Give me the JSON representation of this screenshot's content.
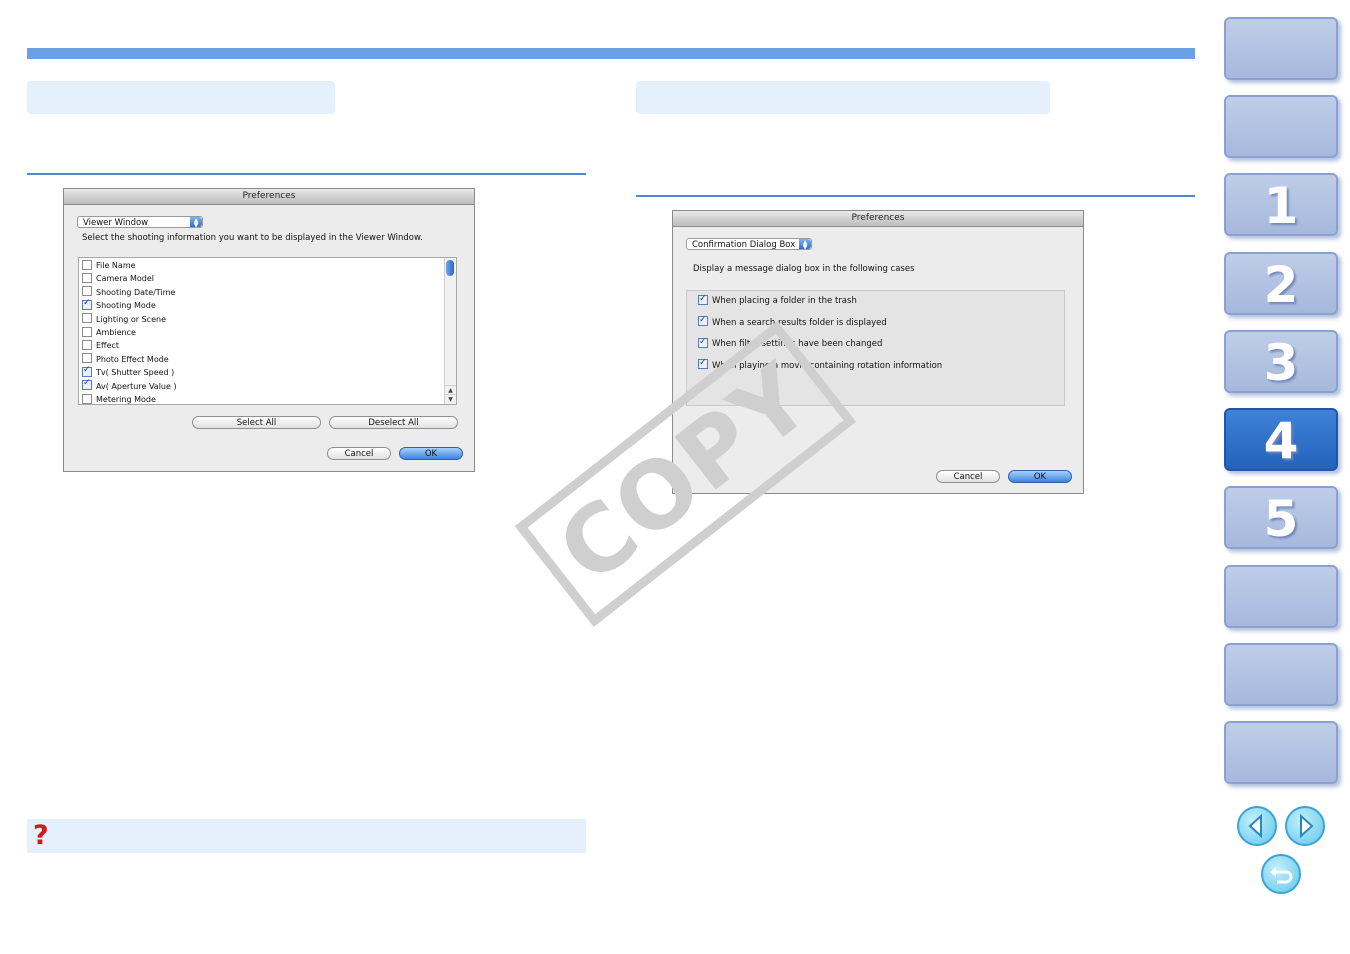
{
  "left_dialog": {
    "title": "Preferences",
    "popup": "Viewer Window",
    "instruction": "Select the shooting information you want to be displayed in the Viewer Window.",
    "items": [
      {
        "label": "File Name",
        "checked": false
      },
      {
        "label": "Camera Model",
        "checked": false
      },
      {
        "label": "Shooting Date/Time",
        "checked": false
      },
      {
        "label": "Shooting Mode",
        "checked": true
      },
      {
        "label": "Lighting or Scene",
        "checked": false
      },
      {
        "label": "Ambience",
        "checked": false
      },
      {
        "label": "Effect",
        "checked": false
      },
      {
        "label": "Photo Effect Mode",
        "checked": false
      },
      {
        "label": "Tv( Shutter Speed )",
        "checked": true
      },
      {
        "label": "Av( Aperture Value )",
        "checked": true
      },
      {
        "label": "Metering Mode",
        "checked": false
      }
    ],
    "select_all": "Select All",
    "deselect_all": "Deselect All",
    "cancel": "Cancel",
    "ok": "OK"
  },
  "right_dialog": {
    "title": "Preferences",
    "popup": "Confirmation Dialog Box",
    "instruction": "Display a message dialog box in the following cases",
    "items": [
      {
        "label": "When placing a folder in the trash",
        "checked": true
      },
      {
        "label": "When a search results folder is displayed",
        "checked": true
      },
      {
        "label": "When filter settings have been changed",
        "checked": true
      },
      {
        "label": "When playing a movie containing rotation information",
        "checked": true
      }
    ],
    "cancel": "Cancel",
    "ok": "OK"
  },
  "watermark": "COPY",
  "help_icon": "?",
  "nav": {
    "tabs": [
      {
        "label": "",
        "active": false
      },
      {
        "label": "",
        "active": false
      },
      {
        "label": "1",
        "active": false
      },
      {
        "label": "2",
        "active": false
      },
      {
        "label": "3",
        "active": false
      },
      {
        "label": "4",
        "active": true
      },
      {
        "label": "5",
        "active": false
      },
      {
        "label": "",
        "active": false
      },
      {
        "label": "",
        "active": false
      },
      {
        "label": "",
        "active": false
      }
    ],
    "icons": [
      "prev-page-icon",
      "next-page-icon",
      "return-icon"
    ]
  },
  "colors": {
    "accent": "#6aa0e4",
    "section_bg": "#e4f0fc",
    "active_tab": "#2462bb",
    "help_red": "#d31a1a"
  }
}
